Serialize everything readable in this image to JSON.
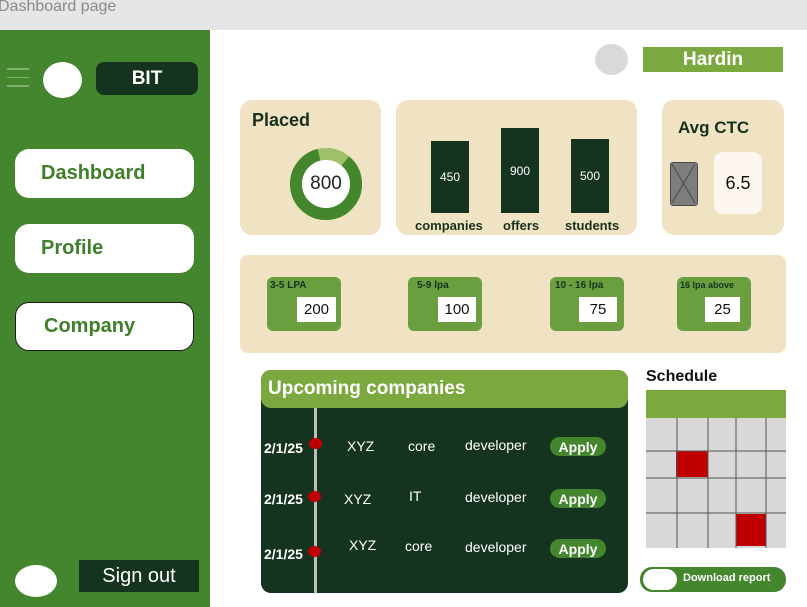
{
  "window": {
    "title": "Dashboard page"
  },
  "sidebar": {
    "brand": "BIT",
    "items": [
      {
        "label": "Dashboard"
      },
      {
        "label": "Profile"
      },
      {
        "label": "Company"
      }
    ],
    "signout_label": "Sign out"
  },
  "header": {
    "user_name": "Hardin"
  },
  "placed": {
    "title": "Placed",
    "value": "800",
    "fill_fraction": 0.85
  },
  "stats": {
    "bars": [
      {
        "value": "450",
        "label": "companies"
      },
      {
        "value": "900",
        "label": "offers"
      },
      {
        "value": "500",
        "label": "students"
      }
    ]
  },
  "avg_ctc": {
    "title": "Avg CTC",
    "value": "6.5"
  },
  "ctc_ranges": [
    {
      "label": "3-5 LPA",
      "value": "200"
    },
    {
      "label": "5-9 lpa",
      "value": "100"
    },
    {
      "label": "10 - 16 lpa",
      "value": "75"
    },
    {
      "label": "16 lpa above",
      "value": "25"
    }
  ],
  "upcoming": {
    "title": "Upcoming companies",
    "apply_label": "Apply",
    "rows": [
      {
        "date": "2/1/25",
        "company": "XYZ",
        "type": "core",
        "role": "developer"
      },
      {
        "date": "2/1/25",
        "company": "XYZ",
        "type": "IT",
        "role": "developer"
      },
      {
        "date": "2/1/25",
        "company": "XYZ",
        "type": "core",
        "role": "developer"
      }
    ]
  },
  "schedule": {
    "title": "Schedule",
    "download_label": "Download report"
  },
  "colors": {
    "sidebar": "#43862e",
    "dark_green": "#15341f",
    "accent_green": "#7ba83f",
    "card_beige": "#efe3c3",
    "highlight_red": "#c00000"
  }
}
